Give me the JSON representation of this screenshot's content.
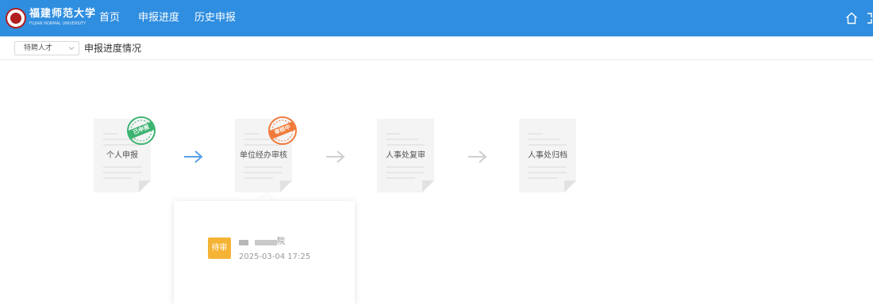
{
  "header": {
    "logo_cn": "福建师范大学",
    "logo_en": "FUJIAN NORMAL UNIVERSITY",
    "nav": [
      {
        "label": "首页"
      },
      {
        "label": "申报进度"
      },
      {
        "label": "历史申报"
      }
    ],
    "icons": [
      "home-icon",
      "expand-icon"
    ]
  },
  "subheader": {
    "type_select_value": "特聘人才",
    "title": "申报进度情况"
  },
  "steps": [
    {
      "label": "个人申报",
      "stamp": "已申报",
      "stamp_color": "#3cb371",
      "state": "done"
    },
    {
      "label": "单位经办审核",
      "stamp": "审核中",
      "stamp_color": "#f07a3a",
      "state": "current"
    },
    {
      "label": "人事处复审",
      "state": "pending"
    },
    {
      "label": "人事处归档",
      "state": "pending"
    }
  ],
  "arrows": [
    {
      "color": "#5aa0e8"
    },
    {
      "color": "#cfcfcf"
    },
    {
      "color": "#cfcfcf"
    }
  ],
  "popover": {
    "status": "待审",
    "status_color": "#f5b335",
    "reviewer_suffix": "院",
    "time": "2025-03-04  17:25"
  }
}
